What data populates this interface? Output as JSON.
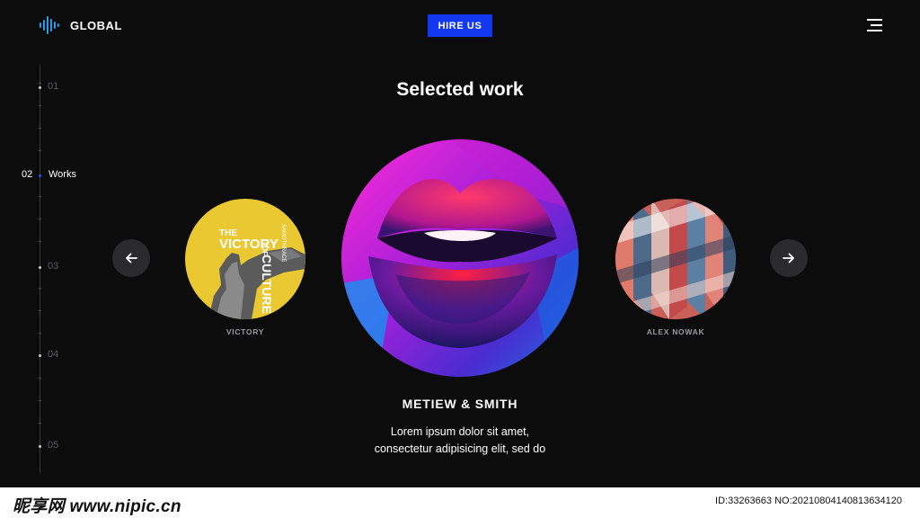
{
  "header": {
    "logo_text": "GLOBAL",
    "hire_label": "HIRE US",
    "accent": "#1338f0"
  },
  "side_nav": {
    "items": [
      {
        "num": "01",
        "label": ""
      },
      {
        "num": "02",
        "label": "Works",
        "active": true
      },
      {
        "num": "03",
        "label": ""
      },
      {
        "num": "04",
        "label": ""
      },
      {
        "num": "05",
        "label": ""
      }
    ]
  },
  "main": {
    "title": "Selected work",
    "left_card": {
      "caption": "VICTORY",
      "art_title_1": "THE",
      "art_title_2": "VICTORY",
      "art_title_3": "CULTURE",
      "art_small": "SAMOTHRACE",
      "art_of": "OF"
    },
    "center_card": {
      "name": "METIEW & SMITH",
      "desc_line_1": "Lorem ipsum dolor sit amet,",
      "desc_line_2": "consectetur adipisicing elit, sed do"
    },
    "right_card": {
      "caption": "ALEX NOWAK"
    },
    "prev_icon": "arrow-left-icon",
    "next_icon": "arrow-right-icon"
  },
  "footer": {
    "watermark": "昵享网 www.nipic.cn",
    "id_text": "ID:33263663 NO:20210804140813634120"
  }
}
